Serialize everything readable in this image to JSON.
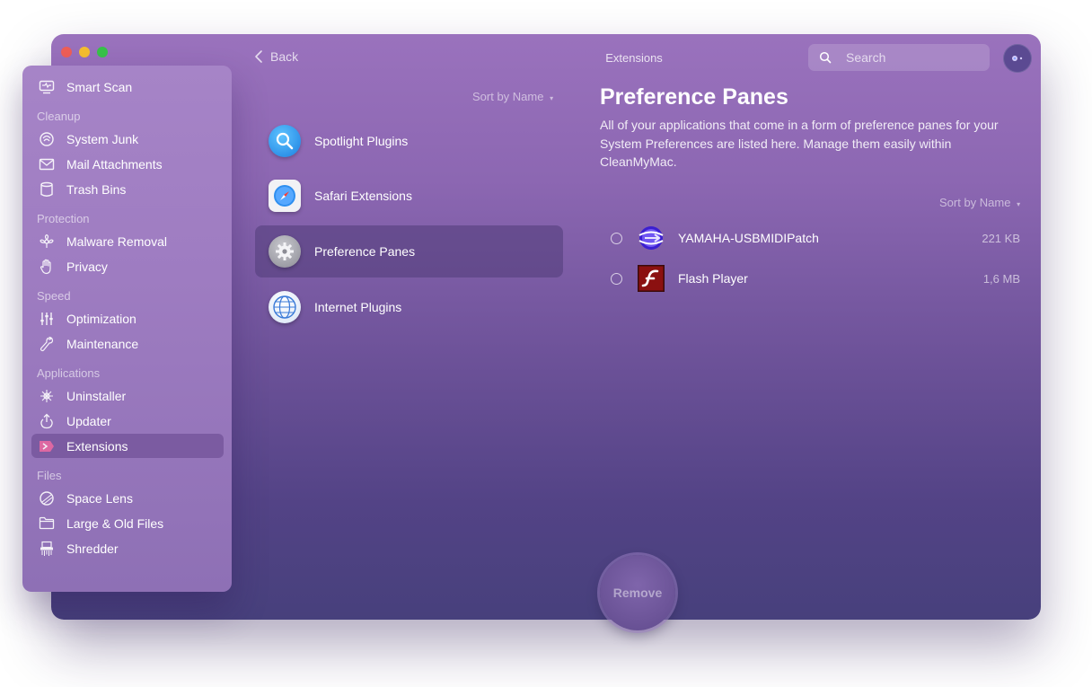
{
  "header": {
    "back_label": "Back",
    "title": "Extensions",
    "search_placeholder": "Search"
  },
  "sidebar": {
    "top": [
      {
        "label": "Smart Scan",
        "icon": "smart-scan-icon"
      }
    ],
    "sections": [
      {
        "title": "Cleanup",
        "items": [
          {
            "label": "System Junk",
            "icon": "system-junk-icon"
          },
          {
            "label": "Mail Attachments",
            "icon": "mail-icon"
          },
          {
            "label": "Trash Bins",
            "icon": "trash-icon"
          }
        ]
      },
      {
        "title": "Protection",
        "items": [
          {
            "label": "Malware Removal",
            "icon": "biohazard-icon"
          },
          {
            "label": "Privacy",
            "icon": "hand-icon"
          }
        ]
      },
      {
        "title": "Speed",
        "items": [
          {
            "label": "Optimization",
            "icon": "sliders-icon"
          },
          {
            "label": "Maintenance",
            "icon": "wrench-icon"
          }
        ]
      },
      {
        "title": "Applications",
        "items": [
          {
            "label": "Uninstaller",
            "icon": "uninstaller-icon"
          },
          {
            "label": "Updater",
            "icon": "updater-icon"
          },
          {
            "label": "Extensions",
            "icon": "extensions-icon",
            "active": true
          }
        ]
      },
      {
        "title": "Files",
        "items": [
          {
            "label": "Space Lens",
            "icon": "space-lens-icon"
          },
          {
            "label": "Large & Old Files",
            "icon": "folder-icon"
          },
          {
            "label": "Shredder",
            "icon": "shredder-icon"
          }
        ]
      }
    ]
  },
  "categories": {
    "sort_label": "Sort by Name",
    "items": [
      {
        "label": "Spotlight Plugins",
        "icon": "spotlight-icon"
      },
      {
        "label": "Safari Extensions",
        "icon": "safari-icon"
      },
      {
        "label": "Preference Panes",
        "icon": "gear-icon",
        "active": true
      },
      {
        "label": "Internet Plugins",
        "icon": "globe-icon"
      }
    ]
  },
  "pane": {
    "title": "Preference Panes",
    "description": "All of your applications that come in a form of preference panes for your System Preferences are listed here. Manage them easily within CleanMyMac.",
    "sort_label": "Sort by Name",
    "items": [
      {
        "name": "YAMAHA-USBMIDIPatch",
        "size": "221 KB",
        "icon": "yamaha-icon"
      },
      {
        "name": "Flash Player",
        "size": "1,6 MB",
        "icon": "flash-icon"
      }
    ]
  },
  "remove_label": "Remove",
  "colors": {
    "accent": "#8c67b2",
    "sidebar": "#a684c7",
    "window_bottom": "#47407c"
  }
}
